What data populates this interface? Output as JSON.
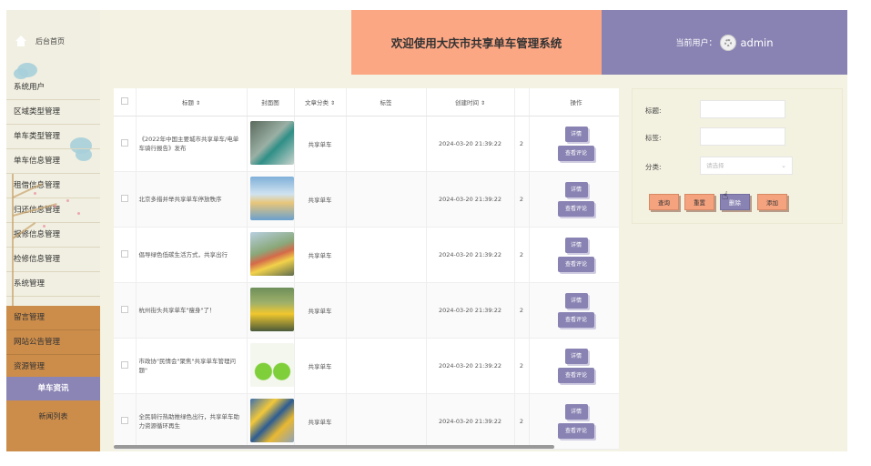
{
  "sidebar": {
    "home_label": "后台首页",
    "items": [
      "系统用户",
      "区域类型管理",
      "单车类型管理",
      "单车信息管理",
      "租借信息管理",
      "归还信息管理",
      "报修信息管理",
      "检修信息管理",
      "系统管理"
    ],
    "items_bottom": [
      "留言管理",
      "网站公告管理",
      "资源管理"
    ],
    "active": "单车资讯",
    "sub": "新闻列表"
  },
  "header": {
    "title": "欢迎使用大庆市共享单车管理系统",
    "user_label": "当前用户：",
    "username": "admin"
  },
  "table": {
    "columns": [
      "标题",
      "封面图",
      "文章分类",
      "标签",
      "创建时间",
      "",
      "操作"
    ],
    "rows": [
      {
        "title": "《2022年中国主要城市共享单车/电单车骑行报告》发布",
        "category": "共享单车",
        "tag": "",
        "created": "2024-03-20 21:39:22",
        "extra": "2",
        "actions": [
          "详情",
          "查看评论"
        ]
      },
      {
        "title": "北京多措并举共享单车停放秩序",
        "category": "共享单车",
        "tag": "",
        "created": "2024-03-20 21:39:22",
        "extra": "2",
        "actions": [
          "详情",
          "查看评论"
        ]
      },
      {
        "title": "倡导绿色低碳生活方式，共享出行",
        "category": "共享单车",
        "tag": "",
        "created": "2024-03-20 21:39:22",
        "extra": "2",
        "actions": [
          "详情",
          "查看评论"
        ]
      },
      {
        "title": "杭州街头共享单车\"瘦身\"了！",
        "category": "共享单车",
        "tag": "",
        "created": "2024-03-20 21:39:22",
        "extra": "2",
        "actions": [
          "详情",
          "查看评论"
        ]
      },
      {
        "title": "市政协\"民情会\"聚焦\"共享单车管理问题\"",
        "category": "共享单车",
        "tag": "",
        "created": "2024-03-20 21:39:22",
        "extra": "2",
        "actions": [
          "详情",
          "查看评论"
        ]
      },
      {
        "title": "全民骑行热助推绿色出行，共享单车助力资源循环再生",
        "category": "共享单车",
        "tag": "",
        "created": "2024-03-20 21:39:22",
        "extra": "2",
        "actions": [
          "详情",
          "查看评论"
        ]
      }
    ]
  },
  "search": {
    "title_label": "标题:",
    "tag_label": "标签:",
    "category_label": "分类:",
    "category_placeholder": "请选择",
    "buttons": {
      "query": "查询",
      "reset": "重置",
      "delete": "删除",
      "add": "添加"
    }
  }
}
